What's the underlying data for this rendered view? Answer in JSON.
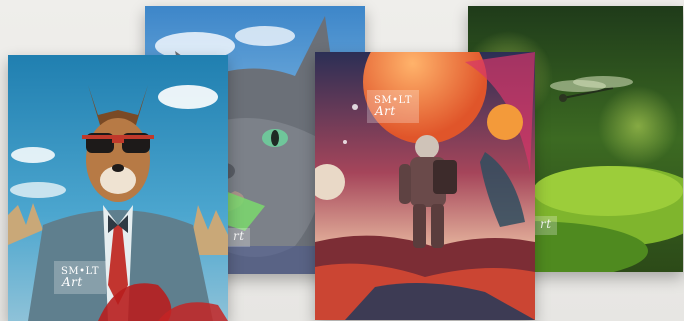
{
  "brand": {
    "logo_main": "SM•LT",
    "logo_script": "Art",
    "logo_partial": "rt"
  },
  "posters": [
    {
      "subject": "dog-in-suit-with-sunglasses"
    },
    {
      "subject": "gray-cat-portrait"
    },
    {
      "subject": "astronaut-on-alien-planet"
    },
    {
      "subject": "dragonfly-over-moss"
    }
  ],
  "colors": {
    "background": "#ecebe8",
    "sky": "#2f8cb8",
    "planet_orange": "#f07b2d",
    "moss_green": "#6fa32a"
  }
}
